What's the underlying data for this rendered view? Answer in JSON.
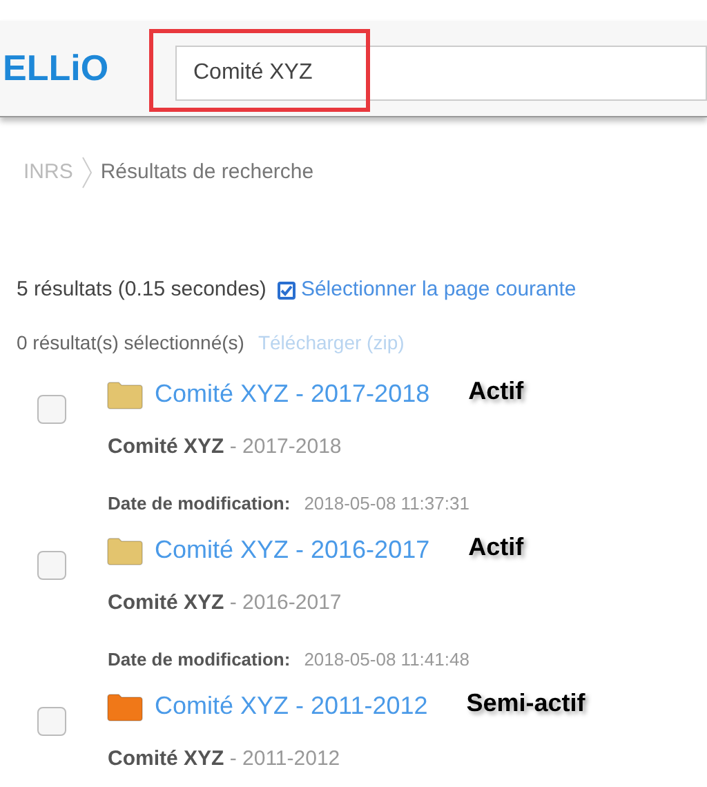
{
  "header": {
    "logo": "ELLiO",
    "search": {
      "value": "Comité XYZ"
    }
  },
  "breadcrumb": [
    "INRS",
    "Résultats de recherche"
  ],
  "summary": {
    "count": "5 résultats (0.15 secondes)",
    "select_page": {
      "label": "Sélectionner la page courante",
      "checked": true
    }
  },
  "selection": {
    "count": "0 résultat(s) sélectionné(s)",
    "download": {
      "label": "Télécharger (zip)",
      "disabled": true
    }
  },
  "results": [
    {
      "title": "Comité XYZ - 2017-2018",
      "color": "#e3c46e",
      "checked": false,
      "status": "Actif",
      "subtitle_bold": "Comité XYZ",
      "subtitle_rest": " - 2017-2018",
      "date_label": "Date de modification:",
      "date_value": "2018-05-08 11:37:31"
    },
    {
      "title": "Comité XYZ - 2016-2017",
      "color": "#e3c46e",
      "checked": false,
      "status": "Actif",
      "subtitle_bold": "Comité XYZ",
      "subtitle_rest": " - 2016-2017",
      "date_label": "Date de modification:",
      "date_value": "2018-05-08 11:41:48"
    },
    {
      "title": "Comité XYZ - 2011-2012",
      "color": "#f07818",
      "checked": false,
      "status": "Semi-actif",
      "subtitle_bold": "Comité XYZ",
      "subtitle_rest": " - 2011-2012"
    }
  ]
}
